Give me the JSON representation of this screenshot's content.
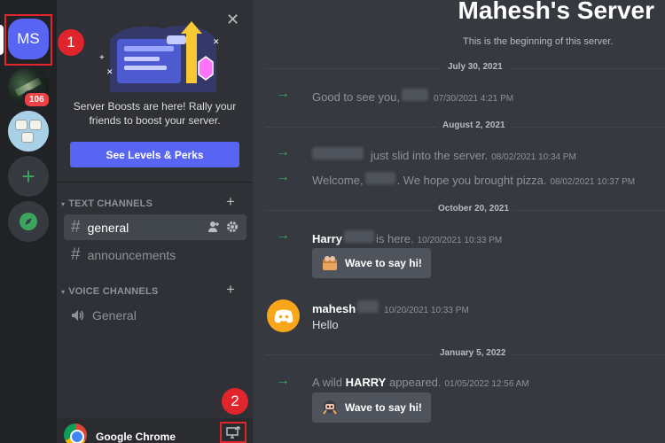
{
  "servers": {
    "current_initials": "MS",
    "photo_badge": "106",
    "step1_marker": "1",
    "step2_marker": "2"
  },
  "boost": {
    "text_line1": "Server Boosts are here! Rally your",
    "text_line2": "friends to boost your server.",
    "button": "See Levels & Perks",
    "close": "✕"
  },
  "categories": {
    "text": "TEXT CHANNELS",
    "voice": "VOICE CHANNELS"
  },
  "channels": {
    "general": "general",
    "announcements": "announcements",
    "voice_general": "General"
  },
  "bottombar": {
    "app_label": "Google Chrome"
  },
  "chat": {
    "server_title": "Mahesh's Server",
    "subtitle": "This is the beginning of this server.",
    "dates": [
      "July 30, 2021",
      "August 2, 2021",
      "October 20, 2021",
      "January 5, 2022"
    ],
    "msg1": {
      "text": "Good to see you,",
      "ts": "07/30/2021 4:21 PM"
    },
    "msg2": {
      "text": "just slid into the server.",
      "ts": "08/02/2021 10:34 PM"
    },
    "msg3": {
      "pre": "Welcome,",
      "post": ". We hope you brought pizza.",
      "ts": "08/02/2021 10:37 PM"
    },
    "msg4": {
      "name": "Harry",
      "text": "is here.",
      "ts": "10/20/2021 10:33 PM"
    },
    "wave_label": "Wave to say hi!",
    "msg5": {
      "name": "mahesh",
      "ts": "10/20/2021 10:33 PM",
      "text": "Hello"
    },
    "msg6": {
      "pre": "A wild",
      "name": "HARRY",
      "post": "appeared.",
      "ts": "01/05/2022 12:56 AM"
    }
  }
}
